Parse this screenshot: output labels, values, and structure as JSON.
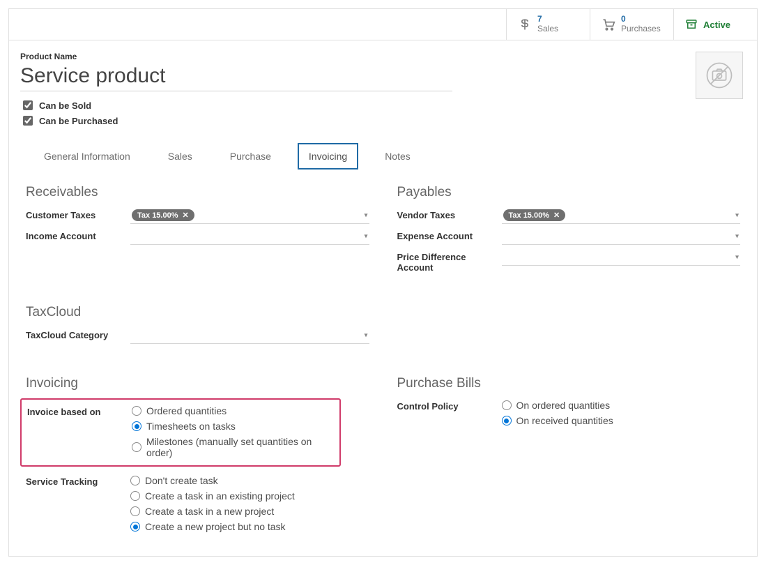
{
  "stats": {
    "sales": {
      "value": "7",
      "label": "Sales"
    },
    "purchases": {
      "value": "0",
      "label": "Purchases"
    },
    "active": {
      "label": "Active"
    }
  },
  "product": {
    "name_label": "Product Name",
    "name": "Service product",
    "can_be_sold_label": "Can be Sold",
    "can_be_purchased_label": "Can be Purchased"
  },
  "tabs": {
    "general": "General Information",
    "sales": "Sales",
    "purchase": "Purchase",
    "invoicing": "Invoicing",
    "notes": "Notes"
  },
  "sections": {
    "receivables": {
      "title": "Receivables",
      "customer_taxes_label": "Customer Taxes",
      "customer_taxes_tag": "Tax 15.00%",
      "income_account_label": "Income Account"
    },
    "payables": {
      "title": "Payables",
      "vendor_taxes_label": "Vendor Taxes",
      "vendor_taxes_tag": "Tax 15.00%",
      "expense_account_label": "Expense Account",
      "price_diff_label": "Price Difference Account"
    },
    "taxcloud": {
      "title": "TaxCloud",
      "category_label": "TaxCloud Category"
    },
    "invoicing": {
      "title": "Invoicing",
      "invoice_based_label": "Invoice based on",
      "options": {
        "ordered": "Ordered quantities",
        "timesheets": "Timesheets on tasks",
        "milestones": "Milestones (manually set quantities on order)"
      },
      "service_tracking_label": "Service Tracking",
      "tracking": {
        "none": "Don't create task",
        "existing": "Create a task in an existing project",
        "newproj": "Create a task in a new project",
        "project_only": "Create a new project but no task"
      }
    },
    "purchase_bills": {
      "title": "Purchase Bills",
      "control_policy_label": "Control Policy",
      "options": {
        "ordered": "On ordered quantities",
        "received": "On received quantities"
      }
    }
  }
}
